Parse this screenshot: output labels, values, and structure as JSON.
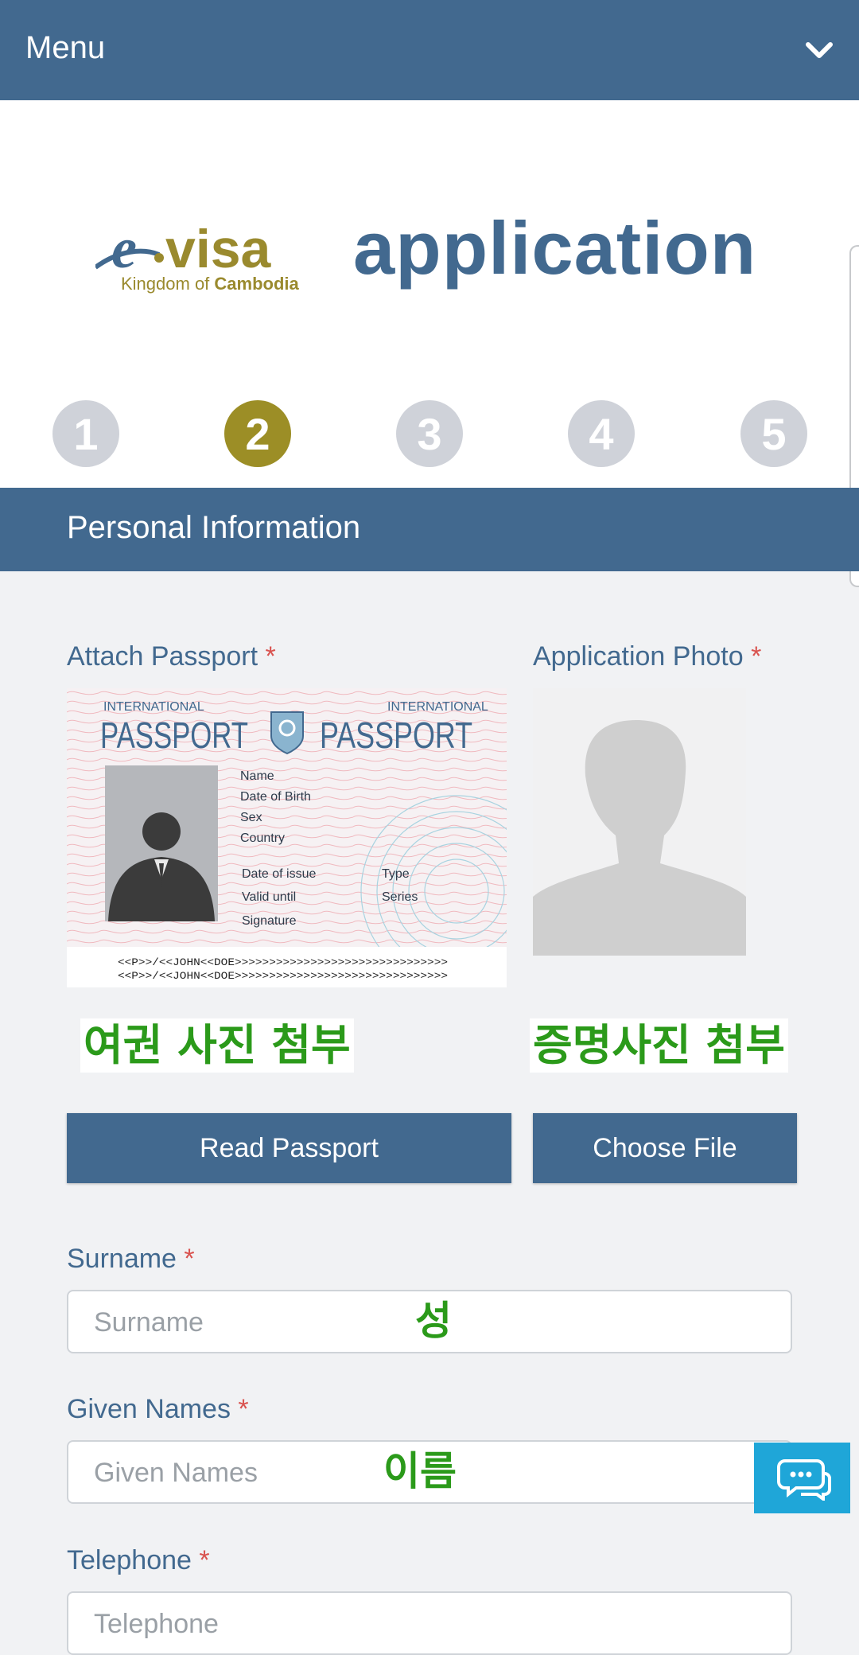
{
  "topbar": {
    "menu_label": "Menu",
    "toggle_icon": "chevron-down-icon"
  },
  "branding": {
    "logo_text": "e.visa",
    "logo_sub_prefix": "Kingdom of",
    "logo_sub_bold": "Cambodia",
    "title": "application"
  },
  "steps": [
    {
      "label": "1",
      "active": false
    },
    {
      "label": "2",
      "active": true
    },
    {
      "label": "3",
      "active": false
    },
    {
      "label": "4",
      "active": false
    },
    {
      "label": "5",
      "active": false
    }
  ],
  "section": {
    "title": "Personal Information"
  },
  "passport": {
    "label": "Attach Passport",
    "required_mark": "*",
    "sample": {
      "header_left": "INTERNATIONAL",
      "header_right": "INTERNATIONAL",
      "word": "PASSPORT",
      "fields_top": [
        "Name",
        "Date of Birth",
        "Sex",
        "Country"
      ],
      "fields_left": [
        "Date of issue",
        "Valid until",
        "Signature"
      ],
      "fields_right": [
        "Type",
        "Series"
      ],
      "mrz_line1": "<<P>>/<<JOHN<<DOE>>>>>>>>>>>>>>>>>>>>>>>>>>>>>>>",
      "mrz_line2": "<<P>>/<<JOHN<<DOE>>>>>>>>>>>>>>>>>>>>>>>>>>>>>>>"
    },
    "note_kr": "여권 사진 첨부",
    "button": "Read Passport"
  },
  "photo": {
    "label": "Application Photo",
    "required_mark": "*",
    "note_kr": "증명사진 첨부",
    "button": "Choose File"
  },
  "fields": {
    "surname": {
      "label": "Surname",
      "required_mark": "*",
      "placeholder": "Surname",
      "note_kr": "성"
    },
    "given_names": {
      "label": "Given Names",
      "required_mark": "*",
      "placeholder": "Given Names",
      "note_kr": "이름"
    },
    "telephone": {
      "label": "Telephone",
      "required_mark": "*",
      "placeholder": "Telephone"
    }
  },
  "chat": {
    "icon": "chat-bubbles-icon"
  },
  "colors": {
    "primary": "#42698f",
    "step_active": "#9c8e26",
    "step_inactive": "#cfd2d9",
    "annotation": "#2b9a1a",
    "chat": "#1fa6d8"
  }
}
